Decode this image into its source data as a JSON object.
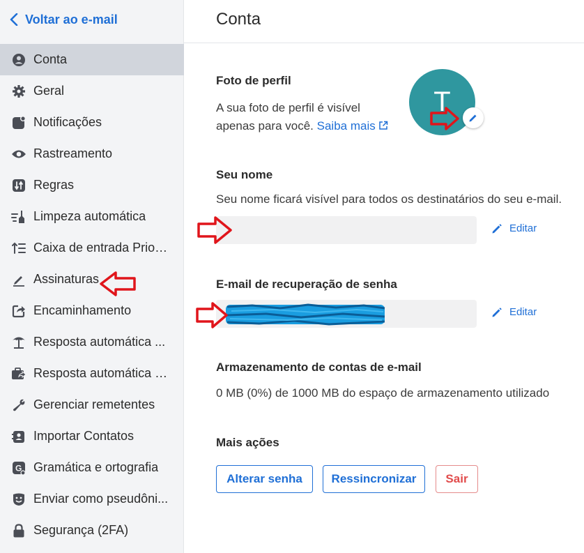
{
  "sidebar": {
    "back_label": "Voltar ao e-mail",
    "items": [
      {
        "label": "Conta",
        "icon": "user-circle-icon",
        "active": true
      },
      {
        "label": "Geral",
        "icon": "gear-icon",
        "active": false
      },
      {
        "label": "Notificações",
        "icon": "notification-icon",
        "active": false
      },
      {
        "label": "Rastreamento",
        "icon": "eye-icon",
        "active": false
      },
      {
        "label": "Regras",
        "icon": "rules-icon",
        "active": false
      },
      {
        "label": "Limpeza automática",
        "icon": "broom-icon",
        "active": false
      },
      {
        "label": "Caixa de entrada Priori...",
        "icon": "priority-icon",
        "active": false
      },
      {
        "label": "Assinaturas",
        "icon": "pen-icon",
        "active": false
      },
      {
        "label": "Encaminhamento",
        "icon": "forward-icon",
        "active": false
      },
      {
        "label": "Resposta automática ...",
        "icon": "beach-icon",
        "active": false
      },
      {
        "label": "Resposta automática e...",
        "icon": "briefcase-reply-icon",
        "active": false
      },
      {
        "label": "Gerenciar remetentes",
        "icon": "wrench-icon",
        "active": false
      },
      {
        "label": "Importar Contatos",
        "icon": "contacts-icon",
        "active": false
      },
      {
        "label": "Gramática e ortografia",
        "icon": "grammar-icon",
        "active": false
      },
      {
        "label": "Enviar como pseudôni...",
        "icon": "mask-icon",
        "active": false
      },
      {
        "label": "Segurança (2FA)",
        "icon": "lock-icon",
        "active": false
      }
    ]
  },
  "header": {
    "title": "Conta"
  },
  "profile": {
    "title": "Foto de perfil",
    "desc_line1": "A sua foto de perfil é visível",
    "desc_line2": "apenas para você.",
    "learn_more": "Saiba mais",
    "avatar_initial": "T",
    "avatar_color": "#2f979f"
  },
  "name": {
    "title": "Seu nome",
    "desc": "Seu nome ficará visível para todos os destinatários do seu e-mail.",
    "value": "",
    "edit_label": "Editar"
  },
  "recovery": {
    "title": "E-mail de recuperação de senha",
    "value": "",
    "edit_label": "Editar"
  },
  "storage": {
    "title": "Armazenamento de contas de e-mail",
    "desc": "0 MB (0%) de 1000 MB do espaço de armazenamento utilizado"
  },
  "actions": {
    "title": "Mais ações",
    "change_password": "Alterar senha",
    "resync": "Ressincronizar",
    "logout": "Sair"
  },
  "colors": {
    "accent": "#1f6fd6",
    "danger": "#e14c4c",
    "annotation": "#e0151b"
  }
}
